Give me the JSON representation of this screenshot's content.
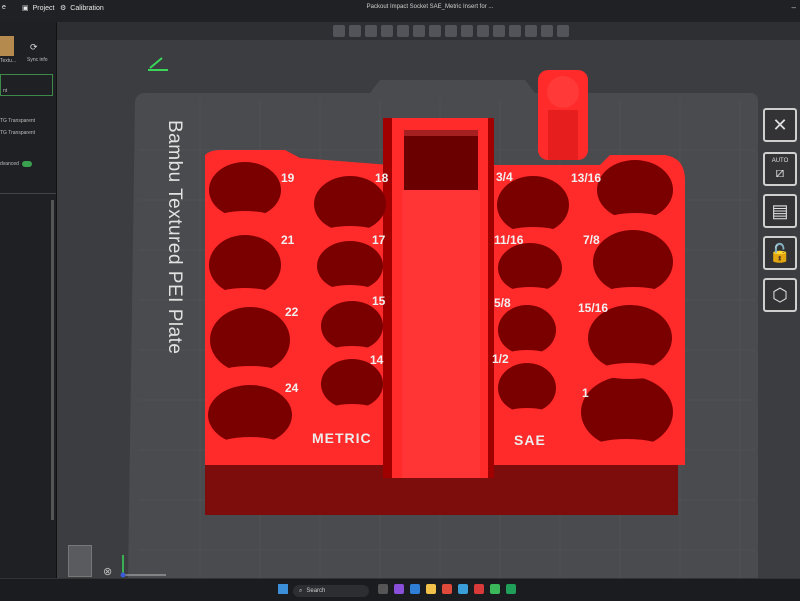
{
  "window": {
    "title": "Packout Impact Socket SAE_Metric Insert for ...",
    "tabs": [
      {
        "label": "e"
      },
      {
        "label": "Project"
      },
      {
        "label": "Calibration"
      }
    ]
  },
  "sidebar": {
    "filament_label": "Textu...",
    "sync_label": "Sync info",
    "field_value": "nt",
    "filaments": [
      {
        "label": "TG Transparent"
      },
      {
        "label": "TG Transparent"
      }
    ],
    "advanced_label": "dvanced"
  },
  "viewport": {
    "plate_label": "Bambu Textured PEI Plate"
  },
  "model": {
    "metric": {
      "title": "METRIC",
      "sizes": [
        "19",
        "18",
        "21",
        "17",
        "22",
        "15",
        "24",
        "14"
      ]
    },
    "sae": {
      "title": "SAE",
      "sizes": [
        "3/4",
        "13/16",
        "11/16",
        "7/8",
        "5/8",
        "15/16",
        "1/2",
        "1"
      ]
    },
    "color": "#ff2a2a",
    "dark": "#7a0000"
  },
  "rightpanel": {
    "auto_label": "AUTO"
  },
  "taskbar": {
    "search": "Search"
  }
}
